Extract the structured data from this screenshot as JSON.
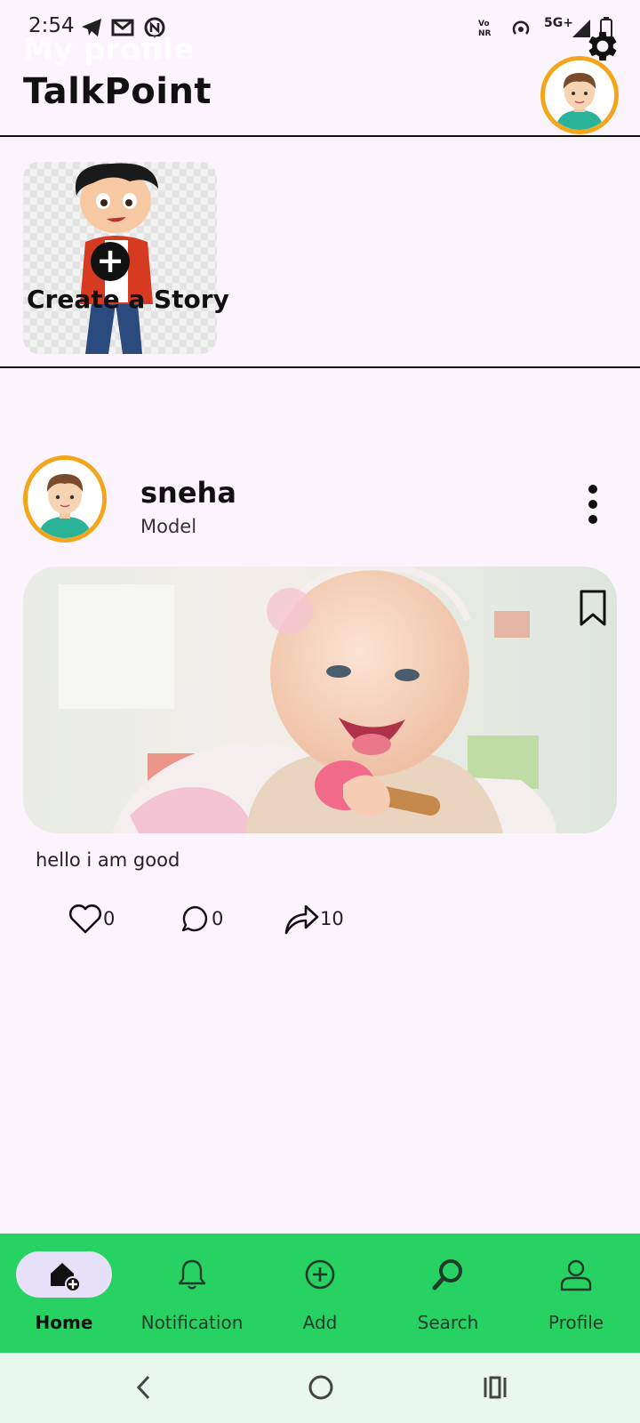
{
  "status_bar": {
    "time": "2:54",
    "network": "5G+"
  },
  "header": {
    "ghost_title": "My profile",
    "app_title": "TalkPoint"
  },
  "story": {
    "label": "Create a Story"
  },
  "post": {
    "username": "sneha",
    "role": "Model",
    "caption": "hello i am good",
    "likes": "0",
    "comments": "0",
    "shares": "10"
  },
  "bottom_nav": {
    "items": [
      {
        "label": "Home",
        "icon": "home-add-icon",
        "active": true
      },
      {
        "label": "Notification",
        "icon": "bell-icon"
      },
      {
        "label": "Add",
        "icon": "add-circle-icon"
      },
      {
        "label": "Search",
        "icon": "search-icon"
      },
      {
        "label": "Profile",
        "icon": "person-icon"
      }
    ]
  },
  "colors": {
    "accent_green": "#27d263",
    "avatar_ring": "#f4a51c",
    "background": "#fcf4fc"
  }
}
